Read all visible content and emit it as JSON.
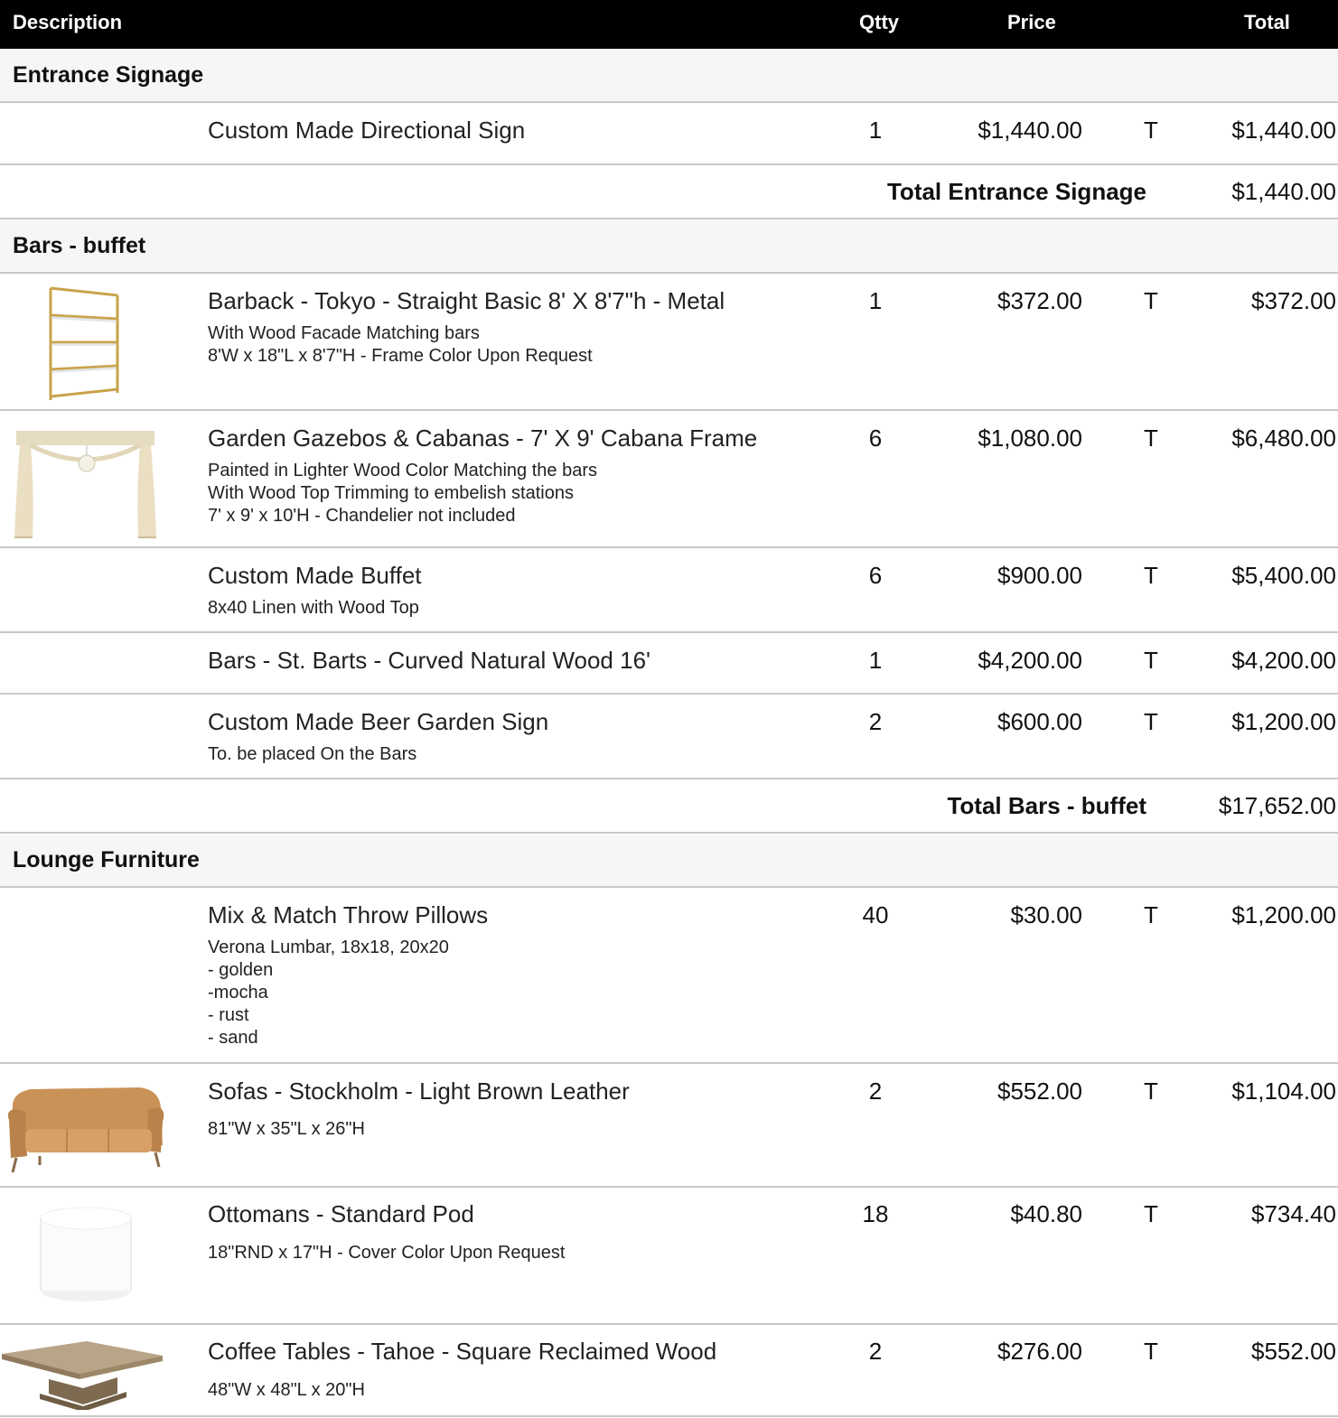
{
  "header": {
    "description": "Description",
    "qty": "Qtty",
    "price": "Price",
    "total": "Total"
  },
  "sections": [
    {
      "name": "Entrance Signage",
      "items": [
        {
          "title": "Custom Made Directional Sign",
          "desc": "",
          "qty": "1",
          "price": "$1,440.00",
          "tax": "T",
          "total": "$1,440.00"
        }
      ],
      "subtotal_label": "Total Entrance Signage",
      "subtotal": "$1,440.00"
    },
    {
      "name": "Bars - buffet",
      "items": [
        {
          "title": "Barback - Tokyo - Straight Basic 8' X 8'7\"h - Metal",
          "desc": "With Wood Facade Matching bars\n8'W x 18\"L x 8'7\"H - Frame Color Upon Request",
          "qty": "1",
          "price": "$372.00",
          "tax": "T",
          "total": "$372.00",
          "icon": "shelf-image"
        },
        {
          "title": "Garden Gazebos & Cabanas - 7' X 9' Cabana Frame",
          "desc": "Painted in Lighter Wood Color Matching the bars\nWith Wood Top Trimming to embelish stations\n7' x 9' x 10'H - Chandelier not included",
          "qty": "6",
          "price": "$1,080.00",
          "tax": "T",
          "total": "$6,480.00",
          "icon": "cabana-image"
        },
        {
          "title": "Custom Made Buffet",
          "desc": "8x40 Linen with Wood Top",
          "qty": "6",
          "price": "$900.00",
          "tax": "T",
          "total": "$5,400.00"
        },
        {
          "title": "Bars - St. Barts - Curved Natural Wood 16'",
          "desc": "",
          "qty": "1",
          "price": "$4,200.00",
          "tax": "T",
          "total": "$4,200.00"
        },
        {
          "title": "Custom Made Beer Garden  Sign",
          "desc": "To. be placed On the Bars",
          "qty": "2",
          "price": "$600.00",
          "tax": "T",
          "total": "$1,200.00"
        }
      ],
      "subtotal_label": "Total Bars - buffet",
      "subtotal": "$17,652.00"
    },
    {
      "name": "Lounge Furniture",
      "items": [
        {
          "title": "Mix & Match Throw Pillows",
          "desc": "Verona Lumbar, 18x18, 20x20\n- golden\n-mocha\n- rust\n- sand",
          "qty": "40",
          "price": "$30.00",
          "tax": "T",
          "total": "$1,200.00"
        },
        {
          "title": "Sofas - Stockholm - Light Brown Leather",
          "desc": "81\"W x 35\"L x 26\"H",
          "qty": "2",
          "price": "$552.00",
          "tax": "T",
          "total": "$1,104.00",
          "icon": "sofa-image"
        },
        {
          "title": "Ottomans - Standard Pod",
          "desc": "18\"RND x 17\"H - Cover Color Upon Request",
          "qty": "18",
          "price": "$40.80",
          "tax": "T",
          "total": "$734.40",
          "icon": "ottoman-image"
        },
        {
          "title": "Coffee Tables - Tahoe - Square Reclaimed Wood",
          "desc": "48\"W x 48\"L x 20\"H",
          "qty": "2",
          "price": "$276.00",
          "tax": "T",
          "total": "$552.00",
          "icon": "coffee-table-image"
        }
      ]
    }
  ]
}
